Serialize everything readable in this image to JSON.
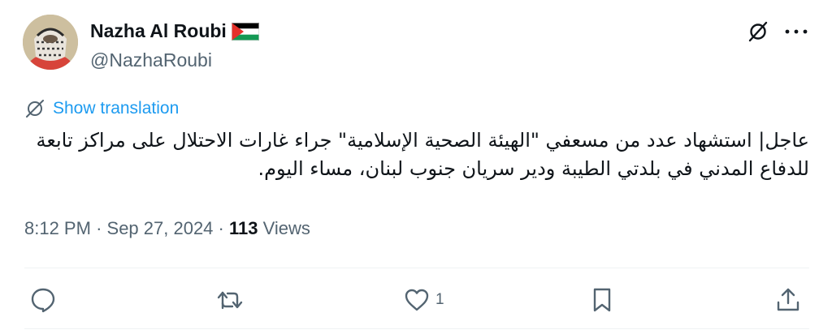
{
  "author": {
    "name": "Nazha Al Roubi",
    "handle": "@NazhaRoubi"
  },
  "translate": {
    "label": "Show translation"
  },
  "tweet": {
    "text": "عاجل| استشهاد عدد من مسعفي \"الهيئة الصحية الإسلامية\" جراء غارات الاحتلال على مراكز تابعة للدفاع المدني في بلدتي الطيبة ودير سريان جنوب لبنان، مساء اليوم."
  },
  "meta": {
    "time": "8:12 PM",
    "date": "Sep 27, 2024",
    "views_count": "113",
    "views_label": "Views",
    "separator": "·"
  },
  "actions": {
    "like_count": "1"
  },
  "icons": {
    "grok": "grok-icon",
    "more": "more-icon",
    "translate": "translate-icon",
    "reply": "reply-icon",
    "repost": "repost-icon",
    "like": "heart-icon",
    "bookmark": "bookmark-icon",
    "share": "share-icon"
  },
  "colors": {
    "link": "#1d9bf0",
    "text": "#0f1419",
    "secondary": "#536471",
    "divider": "#eff3f4"
  }
}
